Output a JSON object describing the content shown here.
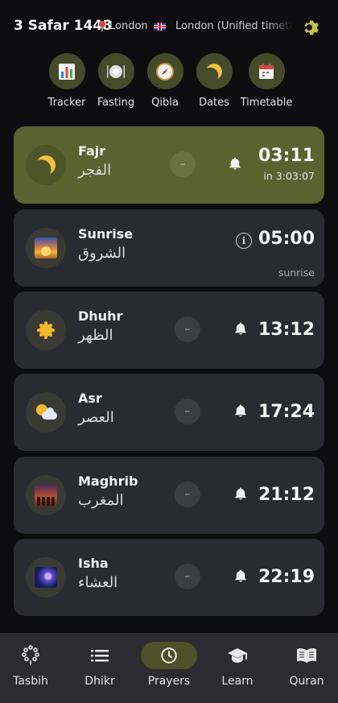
{
  "header": {
    "date": "3 Safar 1448",
    "location": "London",
    "timetable": "London (Unified timetable)"
  },
  "quick_actions": [
    {
      "label": "Tracker",
      "icon": "tracker-chart-icon"
    },
    {
      "label": "Fasting",
      "icon": "fasting-plate-icon"
    },
    {
      "label": "Qibla",
      "icon": "compass-icon"
    },
    {
      "label": "Dates",
      "icon": "crescent-moon-icon"
    },
    {
      "label": "Timetable",
      "icon": "calendar-icon"
    }
  ],
  "prayers": [
    {
      "name": "Fajr",
      "arabic": "الفجر",
      "time": "03:11",
      "countdown": "in 3:03:07",
      "icon": "crescent-moon-icon",
      "active": true
    },
    {
      "name": "Sunrise",
      "arabic": "الشروق",
      "time": "05:00",
      "note": "sunrise",
      "icon": "sunrise-icon"
    },
    {
      "name": "Dhuhr",
      "arabic": "الظهر",
      "time": "13:12",
      "icon": "sun-icon"
    },
    {
      "name": "Asr",
      "arabic": "العصر",
      "time": "17:24",
      "icon": "sun-behind-cloud-icon"
    },
    {
      "name": "Maghrib",
      "arabic": "المغرب",
      "time": "21:12",
      "icon": "sunset-city-icon"
    },
    {
      "name": "Isha",
      "arabic": "العشاء",
      "time": "22:19",
      "icon": "night-sky-icon"
    }
  ],
  "dash_symbol": "–",
  "info_symbol": "i",
  "nav": [
    {
      "label": "Tasbih",
      "icon": "prayer-beads-icon"
    },
    {
      "label": "Dhikr",
      "icon": "list-icon"
    },
    {
      "label": "Prayers",
      "icon": "clock-icon",
      "selected": true
    },
    {
      "label": "Learn",
      "icon": "graduation-cap-icon"
    },
    {
      "label": "Quran",
      "icon": "open-book-icon"
    }
  ],
  "colors": {
    "background": "#0d0d0f",
    "card": "#2a2a31",
    "active_card": "#5a6230",
    "accent": "#c8c84a",
    "nav_bar": "#2b2b30"
  }
}
